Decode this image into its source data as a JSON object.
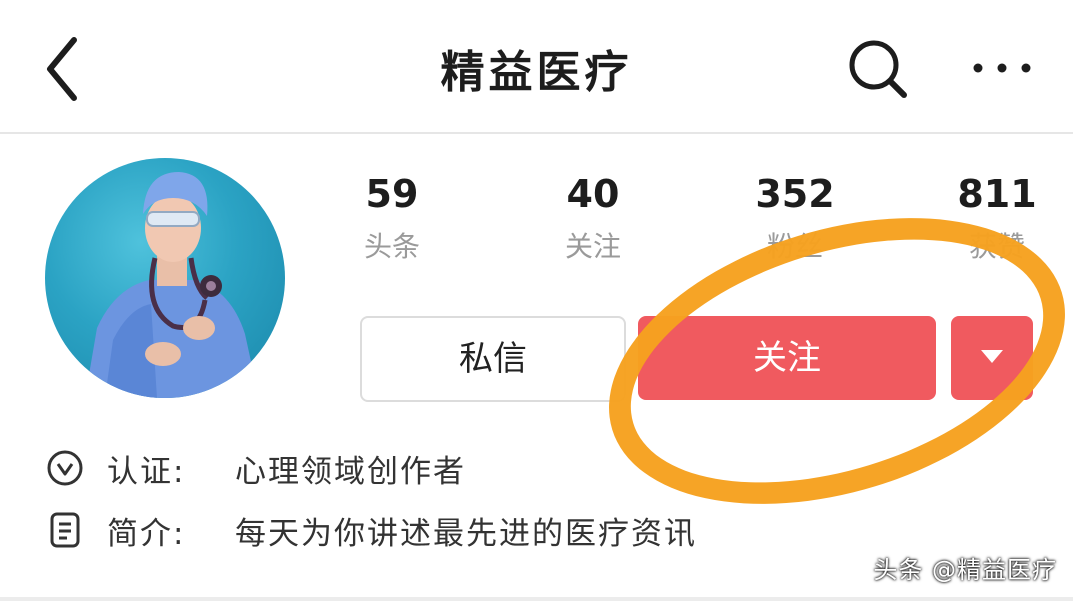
{
  "header": {
    "title": "精益医疗"
  },
  "stats": [
    {
      "value": "59",
      "label": "头条"
    },
    {
      "value": "40",
      "label": "关注"
    },
    {
      "value": "352",
      "label": "粉丝"
    },
    {
      "value": "811",
      "label": "获赞"
    }
  ],
  "actions": {
    "message_label": "私信",
    "follow_label": "关注"
  },
  "info": {
    "verification_key": "认证:",
    "verification_value": "心理领域创作者",
    "bio_key": "简介:",
    "bio_value": "每天为你讲述最先进的医疗资讯"
  },
  "watermark": "头条 @精益医疗",
  "colors": {
    "follow_button": "#f05a5f",
    "annotation": "#f6a11f",
    "avatar_bg": "#2ba3c4"
  }
}
